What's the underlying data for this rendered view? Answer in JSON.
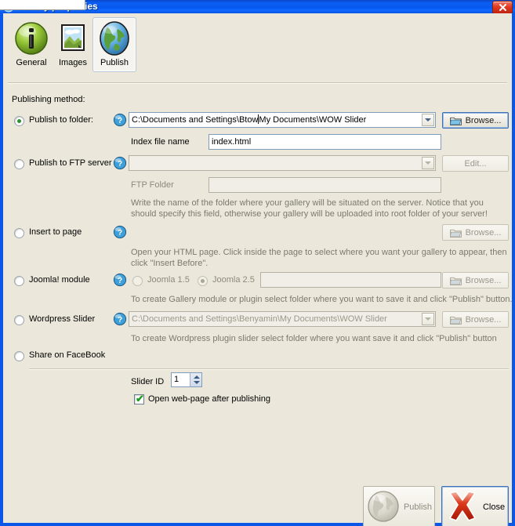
{
  "window": {
    "title": "Gallery properties",
    "close_icon": "close-icon",
    "system_icon": "app-icon"
  },
  "tabs": [
    {
      "label": "General",
      "icon": "info-icon",
      "selected": false
    },
    {
      "label": "Images",
      "icon": "picture-icon",
      "selected": false
    },
    {
      "label": "Publish",
      "icon": "globe-icon",
      "selected": true
    }
  ],
  "section": {
    "publishing_method_label": "Publishing method:"
  },
  "methods": {
    "publish_to_folder": {
      "label": "Publish to folder:",
      "selected": true,
      "help_icon": "help-globe-icon",
      "path_value": "C:\\Documents and Settings\\Btow",
      "path_value_after_caret": "My Documents\\WOW Slider",
      "browse_label": "Browse...",
      "index_label": "Index file name",
      "index_value": "index.html"
    },
    "publish_to_ftp": {
      "label": "Publish to FTP server",
      "selected": false,
      "help_icon": "help-globe-icon",
      "server_value": "",
      "edit_label": "Edit...",
      "ftp_folder_label": "FTP Folder",
      "ftp_folder_value": "",
      "hint_line1": "Write the name of the folder where your gallery will be situated on the server. Notice that you",
      "hint_line2": "should specify this field, otherwise your gallery will be uploaded into root folder of your server!"
    },
    "insert_to_page": {
      "label": "Insert to page",
      "selected": false,
      "help_icon": "help-globe-icon",
      "browse_label": "Browse...",
      "hint_line1": "Open your HTML page. Click inside the page to select where you want your gallery to appear, then",
      "hint_line2": "click \"Insert Before\"."
    },
    "joomla_module": {
      "label": "Joomla! module",
      "selected": false,
      "help_icon": "help-globe-icon",
      "version_15_label": "Joomla 1.5",
      "version_25_label": "Joomla 2.5",
      "version_selected": "Joomla 2.5",
      "path_value": "",
      "browse_label": "Browse...",
      "hint_line1": "To create Gallery module or plugin select folder where you want to save it and click \"Publish\" button."
    },
    "wordpress_slider": {
      "label": "Wordpress Slider",
      "selected": false,
      "help_icon": "help-globe-icon",
      "path_value": "C:\\Documents and Settings\\Benyamin\\My Documents\\WOW Slider",
      "browse_label": "Browse...",
      "hint_line1": "To create Wordpress plugin slider select folder where you want save it and click \"Publish\" button"
    },
    "share_on_facebook": {
      "label": "Share on FaceBook",
      "selected": false
    }
  },
  "options": {
    "slider_id_label": "Slider ID",
    "slider_id_value": "1",
    "open_webpage_label": "Open web-page after publishing",
    "open_webpage_checked": true
  },
  "footer": {
    "publish_label": "Publish",
    "publish_icon": "globe-icon",
    "publish_enabled": false,
    "close_label": "Close",
    "close_icon": "red-x-icon"
  },
  "colors": {
    "titlebar_blue": "#0a57e8",
    "dialog_bg": "#ebe8db",
    "field_border": "#7f9db9",
    "accent_green": "#2f8e2f",
    "close_red": "#cc2200"
  }
}
